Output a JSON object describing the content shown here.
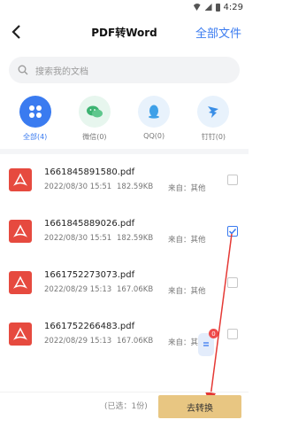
{
  "status_bar": {
    "time": "4:29"
  },
  "header": {
    "title": "PDF转Word",
    "right_link": "全部文件"
  },
  "search": {
    "placeholder": "搜索我的文档"
  },
  "categories": [
    {
      "label": "全部(4)",
      "icon": "grid-icon",
      "active": true
    },
    {
      "label": "微信(0)",
      "icon": "wechat-icon",
      "active": false
    },
    {
      "label": "QQ(0)",
      "icon": "qq-icon",
      "active": false
    },
    {
      "label": "钉钉(0)",
      "icon": "dingtalk-icon",
      "active": false
    }
  ],
  "files": [
    {
      "name": "1661845891580.pdf",
      "date": "2022/08/30 15:51",
      "size": "182.59KB",
      "source": "来自：其他",
      "checked": false
    },
    {
      "name": "1661845889026.pdf",
      "date": "2022/08/30 15:51",
      "size": "182.59KB",
      "source": "来自：其他",
      "checked": true
    },
    {
      "name": "1661752273073.pdf",
      "date": "2022/08/29 15:13",
      "size": "167.06KB",
      "source": "来自：其他",
      "checked": false
    },
    {
      "name": "1661752266483.pdf",
      "date": "2022/08/29 15:13",
      "size": "167.06KB",
      "source": "来自：其他",
      "checked": false
    }
  ],
  "floating": {
    "badge": "0"
  },
  "bottom": {
    "selected_text": "(已选：1份)",
    "convert_label": "去转换"
  },
  "colors": {
    "accent": "#3a7bf0",
    "pdf_red": "#e64a3f",
    "convert_bg": "#e8c682",
    "arrow_red": "#e53935"
  }
}
